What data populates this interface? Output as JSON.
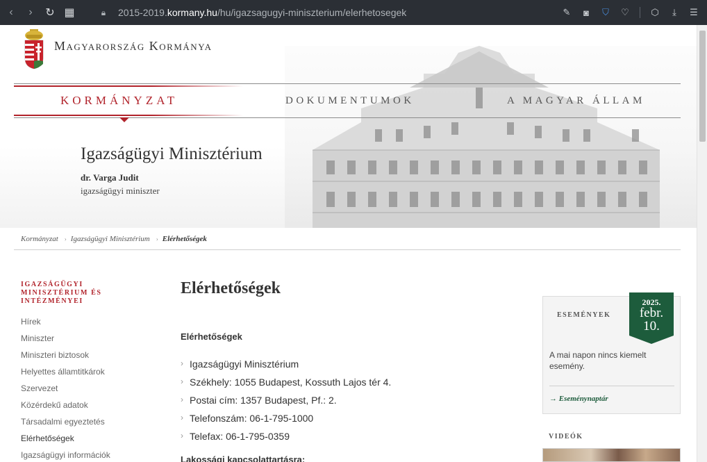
{
  "browser": {
    "url_prefix": "2015-2019.",
    "url_host": "kormany.hu",
    "url_path": "/hu/igazsagugyi-miniszterium/elerhetosegek"
  },
  "site": {
    "name": "Magyarország Kormánya"
  },
  "topnav": {
    "items": [
      "Kormányzat",
      "Dokumentumok",
      "A magyar állam"
    ]
  },
  "ministry": {
    "title": "Igazságügyi Minisztérium",
    "minister_name": "dr. Varga Judit",
    "minister_role": "igazságügyi miniszter"
  },
  "breadcrumb": {
    "items": [
      "Kormányzat",
      "Igazságügyi Minisztérium",
      "Elérhetőségek"
    ]
  },
  "sidebar": {
    "heading": "Igazságügyi Minisztérium és intézményei",
    "items": [
      "Hírek",
      "Miniszter",
      "Miniszteri biztosok",
      "Helyettes államtitkárok",
      "Szervezet",
      "Közérdekű adatok",
      "Társadalmi egyeztetés",
      "Elérhetőségek",
      "Igazságügyi információk"
    ]
  },
  "main": {
    "title": "Elérhetőségek",
    "section_title": "Elérhetőségek",
    "info": [
      "Igazságügyi Minisztérium",
      "Székhely: 1055 Budapest, Kossuth Lajos tér 4.",
      "Postai cím: 1357 Budapest, Pf.: 2.",
      "Telefonszám: 06-1-795-1000",
      "Telefax: 06-1-795-0359"
    ],
    "section_title_2": "Lakossági kapcsolattartásra:"
  },
  "events": {
    "title": "Események",
    "date_year": "2025.",
    "date_month": "febr.",
    "date_day": "10.",
    "text": "A mai napon nincs kiemelt esemény.",
    "link": "→ Eseménynaptár"
  },
  "videos": {
    "title": "Videók"
  },
  "colors": {
    "brand_red": "#b1232b",
    "badge_green": "#1d5c3c",
    "chrome_bg": "#2b2f35"
  }
}
